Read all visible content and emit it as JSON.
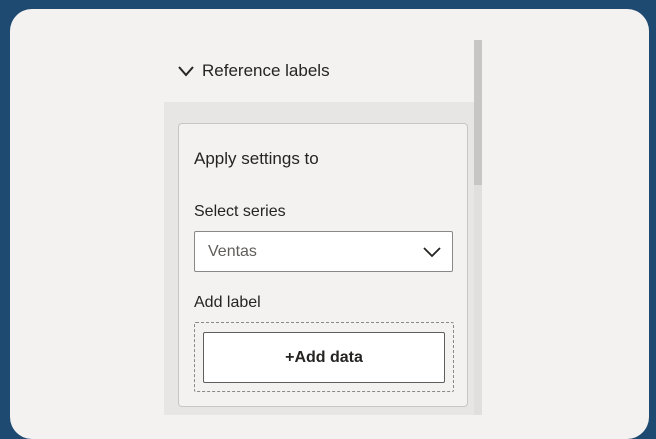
{
  "section": {
    "title": "Reference labels",
    "expanded": true,
    "icon": "chevron-down-icon"
  },
  "settings": {
    "title": "Apply settings to",
    "select_series_label": "Select series",
    "select_series_value": "Ventas",
    "add_label_label": "Add label",
    "add_data_button": "+Add data"
  },
  "colors": {
    "background": "#1e4a72",
    "panel": "#f3f2f1",
    "text": "#252423"
  }
}
